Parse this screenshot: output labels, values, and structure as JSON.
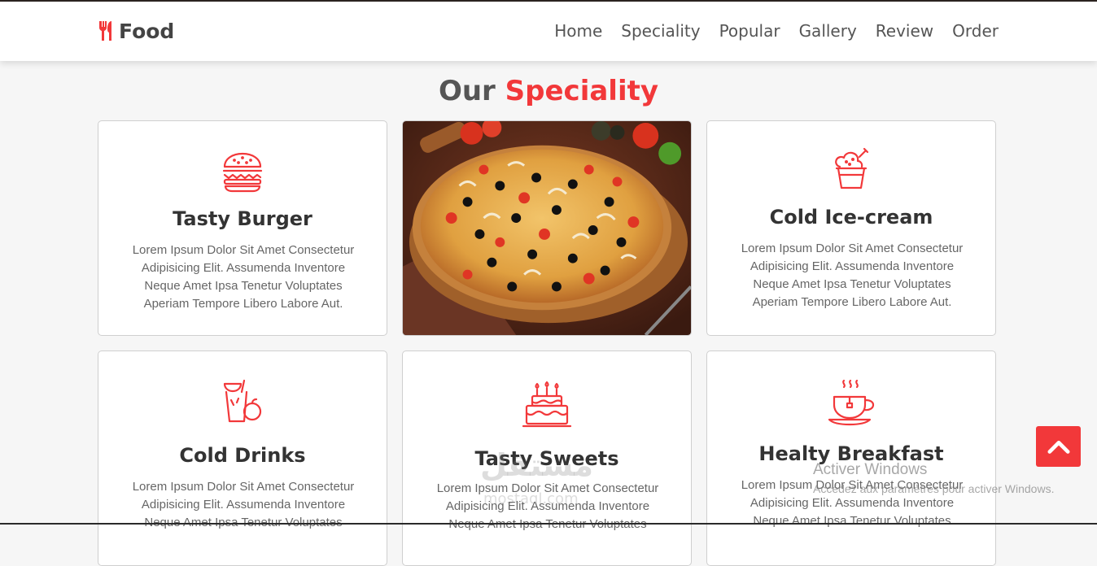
{
  "header": {
    "logo_text": "Food",
    "nav": [
      "Home",
      "Speciality",
      "Popular",
      "Gallery",
      "Review",
      "Order"
    ]
  },
  "section": {
    "title_part1": "Our",
    "title_part2": "Speciality"
  },
  "cards": [
    {
      "title": "Tasty Burger",
      "icon": "burger-icon",
      "text": "Lorem Ipsum Dolor Sit Amet Consectetur Adipisicing Elit. Assumenda Inventore Neque Amet Ipsa Tenetur Voluptates Aperiam Tempore Libero Labore Aut."
    },
    {
      "title": "Cold Ice-cream",
      "icon": "ice-cream-icon",
      "text": "Lorem Ipsum Dolor Sit Amet Consectetur Adipisicing Elit. Assumenda Inventore Neque Amet Ipsa Tenetur Voluptates Aperiam Tempore Libero Labore Aut."
    },
    {
      "title": "Cold Drinks",
      "icon": "drink-icon",
      "text": "Lorem Ipsum Dolor Sit Amet Consectetur Adipisicing Elit. Assumenda Inventore Neque Amet Ipsa Tenetur Voluptates"
    },
    {
      "title": "Tasty Sweets",
      "icon": "cake-icon",
      "text": "Lorem Ipsum Dolor Sit Amet Consectetur Adipisicing Elit. Assumenda Inventore Neque Amet Ipsa Tenetur Voluptates"
    },
    {
      "title": "Healty Breakfast",
      "icon": "coffee-cup-icon",
      "text": "Lorem Ipsum Dolor Sit Amet Consectetur Adipisicing Elit. Assumenda Inventore Neque Amet Ipsa Tenetur Voluptates"
    }
  ],
  "overlay": {
    "watermark": "مستقل",
    "watermark_sub": "mostaql.com",
    "activate_title": "Activer Windows",
    "activate_sub": "Accédez aux paramètres pour activer Windows."
  },
  "colors": {
    "accent": "#f2383a",
    "text": "#333333"
  }
}
